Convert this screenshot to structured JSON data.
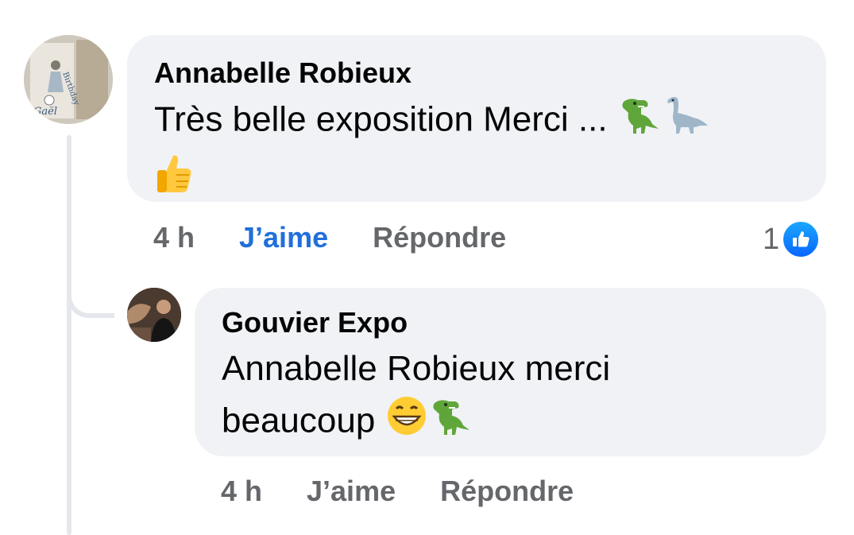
{
  "comment": {
    "author": "Annabelle Robieux",
    "text": "Très belle exposition Merci ...",
    "emojis": [
      "t-rex-icon",
      "sauropod-icon",
      "thumbs-up-icon"
    ],
    "time": "4 h",
    "like_label": "J’aime",
    "reply_label": "Répondre",
    "reaction_count": "1",
    "avatar_text": "Gaël"
  },
  "reply": {
    "author": "Gouvier Expo",
    "text": "Annabelle Robieux merci beaucoup",
    "emojis": [
      "grinning-face-icon",
      "t-rex-icon"
    ],
    "time": "4 h",
    "like_label": "J’aime",
    "reply_label": "Répondre"
  },
  "colors": {
    "bubble": "#f0f2f5",
    "liked_blue": "#216fdb",
    "muted": "#65676b",
    "thread_line": "#e4e6eb"
  }
}
